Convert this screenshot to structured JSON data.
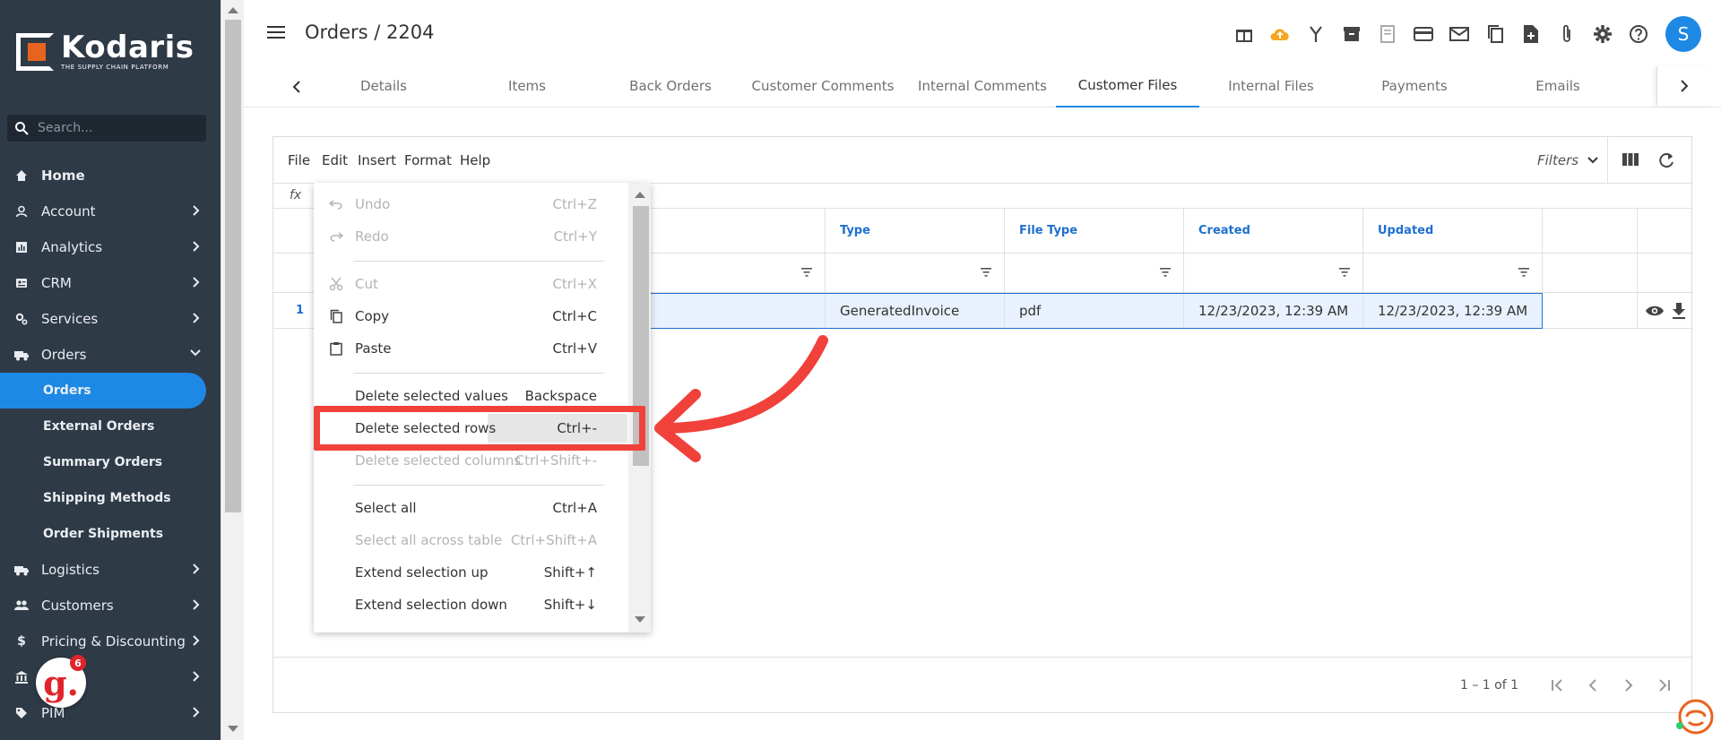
{
  "brand": {
    "name": "Kodaris",
    "tagline": "THE SUPPLY CHAIN PLATFORM"
  },
  "search": {
    "placeholder": "Search..."
  },
  "nav": {
    "items": [
      {
        "label": "Home",
        "icon": "home-icon"
      },
      {
        "label": "Account",
        "icon": "account-icon"
      },
      {
        "label": "Analytics",
        "icon": "analytics-icon"
      },
      {
        "label": "CRM",
        "icon": "crm-icon"
      },
      {
        "label": "Services",
        "icon": "services-icon"
      },
      {
        "label": "Orders",
        "icon": "orders-icon"
      }
    ],
    "orders_sub": [
      "Orders",
      "External Orders",
      "Summary Orders",
      "Shipping Methods",
      "Order Shipments"
    ],
    "items2": [
      {
        "label": "Logistics",
        "icon": "logistics-icon"
      },
      {
        "label": "Customers",
        "icon": "customers-icon"
      },
      {
        "label": "Pricing & Discounting",
        "icon": "dollar-icon"
      },
      {
        "label": "",
        "icon": "bank-icon"
      },
      {
        "label": "PIM",
        "icon": "tag-icon"
      }
    ]
  },
  "header": {
    "title": "Orders / 2204",
    "avatar_letter": "S",
    "icons": [
      "gift-icon",
      "cloud-upload-icon",
      "merge-icon",
      "archive-icon",
      "receipt-icon",
      "credit-card-icon",
      "mail-icon",
      "copy-icon",
      "add-file-icon",
      "attachment-icon",
      "gear-icon",
      "help-icon"
    ]
  },
  "tabs": [
    "Details",
    "Items",
    "Back Orders",
    "Customer Comments",
    "Internal Comments",
    "Customer Files",
    "Internal Files",
    "Payments",
    "Emails"
  ],
  "active_tab": "Customer Files",
  "toolbar": {
    "menus": [
      "File",
      "Edit",
      "Insert",
      "Format",
      "Help"
    ],
    "filters_label": "Filters",
    "fx_label": "fx"
  },
  "table": {
    "columns": [
      "Type",
      "File Type",
      "Created",
      "Updated"
    ],
    "rows": [
      {
        "num": "1",
        "type": "GeneratedInvoice",
        "file_type": "pdf",
        "created": "12/23/2023, 12:39 AM",
        "updated": "12/23/2023, 12:39 AM"
      }
    ],
    "pager": "1 – 1 of 1"
  },
  "context_menu": {
    "undo": {
      "label": "Undo",
      "shortcut": "Ctrl+Z"
    },
    "redo": {
      "label": "Redo",
      "shortcut": "Ctrl+Y"
    },
    "cut": {
      "label": "Cut",
      "shortcut": "Ctrl+X"
    },
    "copy": {
      "label": "Copy",
      "shortcut": "Ctrl+C"
    },
    "paste": {
      "label": "Paste",
      "shortcut": "Ctrl+V"
    },
    "delete_values": {
      "label": "Delete selected values",
      "shortcut": "Backspace"
    },
    "delete_rows": {
      "label": "Delete selected rows",
      "shortcut": "Ctrl+-"
    },
    "delete_columns": {
      "label": "Delete selected columns",
      "shortcut": "Ctrl+Shift+-"
    },
    "select_all": {
      "label": "Select all",
      "shortcut": "Ctrl+A"
    },
    "select_all_table": {
      "label": "Select all across table",
      "shortcut": "Ctrl+Shift+A"
    },
    "extend_up": {
      "label": "Extend selection up",
      "shortcut": "Shift+↑"
    },
    "extend_down": {
      "label": "Extend selection down",
      "shortcut": "Shift+↓"
    }
  },
  "notifications": {
    "g_letter": "g.",
    "g_count": "6"
  },
  "colors": {
    "sidebar": "#2f3a47",
    "accent": "#1e88e5",
    "highlight": "#f0413a",
    "brand_orange": "#e8641e"
  }
}
